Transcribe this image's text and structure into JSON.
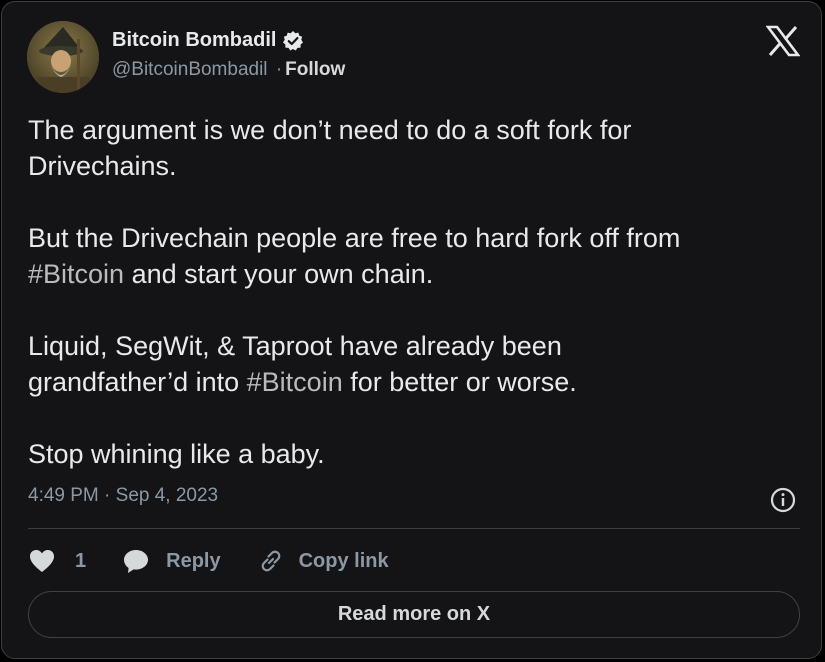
{
  "author": {
    "name": "Bitcoin Bombadil",
    "handle": "@BitcoinBombadil",
    "separator": "·",
    "follow_label": "Follow"
  },
  "tweet": {
    "paragraphs": [
      [
        {
          "text": "The argument is we don’t need to do a soft fork for Drivechains."
        }
      ],
      [
        {
          "text": "But the Drivechain people are free to hard fork off from "
        },
        {
          "hashtag": "#Bitcoin"
        },
        {
          "text": " and start your own chain."
        }
      ],
      [
        {
          "text": "Liquid, SegWit, & Taproot have already been grandfather’d into "
        },
        {
          "hashtag": "#Bitcoin"
        },
        {
          "text": " for better or worse."
        }
      ],
      [
        {
          "text": "Stop whining like a baby."
        }
      ]
    ],
    "p1": "The argument is we don’t need to do a soft fork for",
    "p1b": "Drivechains.",
    "p2a": "But the Drivechain people are free to hard fork off from",
    "p2_hashtag": "#Bitcoin",
    "p2b": " and start your own chain.",
    "p3a": "Liquid, SegWit, & Taproot have already been",
    "p3b": "grandfather’d into ",
    "p3_hashtag": "#Bitcoin",
    "p3c": " for better or worse.",
    "p4": "Stop whining like a baby.",
    "timestamp": "4:49 PM · Sep 4, 2023"
  },
  "actions": {
    "like_count": "1",
    "reply_label": "Reply",
    "copy_link_label": "Copy link"
  },
  "read_more_label": "Read more on X",
  "icons": {
    "verified": "verified-badge-icon",
    "platform": "x-logo-icon",
    "info": "info-icon",
    "like": "heart-icon",
    "reply": "reply-bubble-icon",
    "copy": "link-icon"
  },
  "colors": {
    "background": "#141416",
    "text": "#e7e9ea",
    "muted": "#8b98a5",
    "hashtag": "#b9bcbf",
    "border": "#3c4043"
  }
}
